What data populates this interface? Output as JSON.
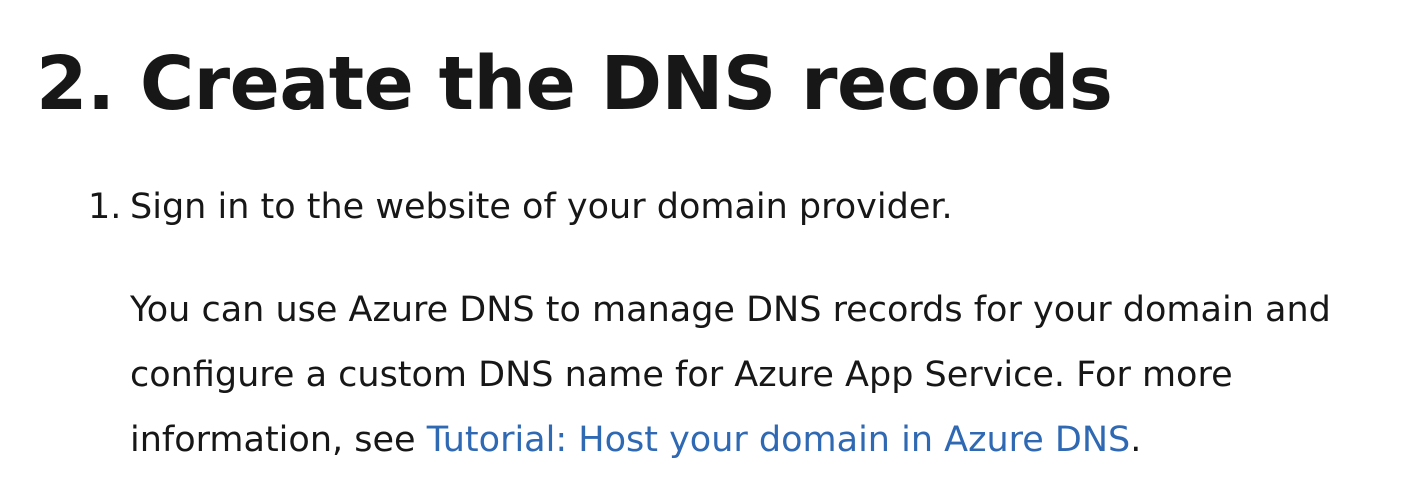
{
  "heading": "2. Create the DNS records",
  "steps": [
    {
      "number": "1.",
      "title": "Sign in to the website of your domain provider.",
      "note": {
        "line1": "You can use Azure DNS to manage DNS records for your domain and",
        "line2": "configure a custom DNS name for Azure App Service. For more",
        "line3_prefix": "information, see ",
        "link_text": "Tutorial: Host your domain in Azure DNS",
        "line3_suffix": "."
      }
    }
  ],
  "colors": {
    "text": "#171717",
    "link": "#2f69b3",
    "background": "#ffffff"
  }
}
